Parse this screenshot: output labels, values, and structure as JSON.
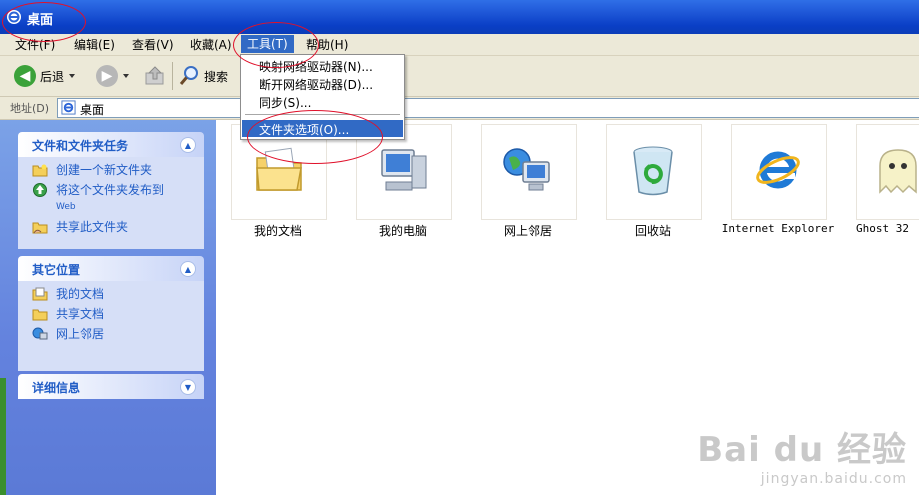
{
  "window": {
    "title": "桌面"
  },
  "menubar": {
    "items": [
      {
        "label": "文件(F)"
      },
      {
        "label": "编辑(E)"
      },
      {
        "label": "查看(V)"
      },
      {
        "label": "收藏(A)"
      },
      {
        "label": "工具(T)"
      },
      {
        "label": "帮助(H)"
      }
    ]
  },
  "tools_menu": {
    "items": [
      {
        "label": "映射网络驱动器(N)..."
      },
      {
        "label": "断开网络驱动器(D)..."
      },
      {
        "label": "同步(S)..."
      },
      {
        "label": "文件夹选项(O)..."
      }
    ],
    "highlighted": "文件夹选项(O)..."
  },
  "toolbar": {
    "back_label": "后退",
    "search_label": "搜索"
  },
  "addressbar": {
    "label": "地址(D)",
    "value": "桌面"
  },
  "left_pane": {
    "file_tasks": {
      "title": "文件和文件夹任务",
      "items": [
        {
          "label": "创建一个新文件夹"
        },
        {
          "label": "将这个文件夹发布到",
          "sub": "Web"
        },
        {
          "label": "共享此文件夹"
        }
      ]
    },
    "other_places": {
      "title": "其它位置",
      "items": [
        {
          "label": "我的文档"
        },
        {
          "label": "共享文档"
        },
        {
          "label": "网上邻居"
        }
      ]
    },
    "details": {
      "title": "详细信息"
    }
  },
  "desktop_items": [
    {
      "label": "我的文档",
      "icon": "my-documents-icon"
    },
    {
      "label": "我的电脑",
      "icon": "my-computer-icon"
    },
    {
      "label": "网上邻居",
      "icon": "network-places-icon"
    },
    {
      "label": "回收站",
      "icon": "recycle-bin-icon"
    },
    {
      "label": "Internet Explorer",
      "icon": "internet-explorer-icon"
    },
    {
      "label": "Ghost 32",
      "icon": "ghost-icon"
    }
  ],
  "watermark": {
    "main": "Bai du 经验",
    "sub": "jingyan.baidu.com"
  },
  "colors": {
    "titlebar": "#0a3fc6",
    "highlight": "#316ac5",
    "annotation": "#e0112b",
    "task_text": "#215dc6"
  }
}
